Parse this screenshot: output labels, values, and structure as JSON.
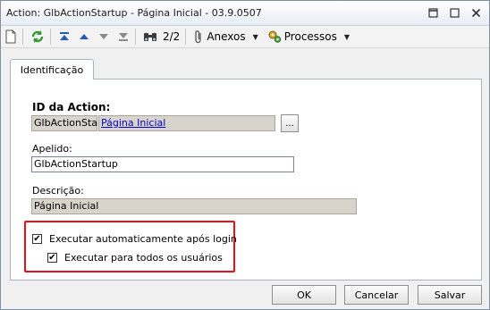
{
  "window": {
    "title": "Action: GlbActionStartup - Página Inicial - 03.9.0507"
  },
  "toolbar": {
    "pager": "2/2",
    "anexos_label": "Anexos",
    "processos_label": "Processos"
  },
  "tabs": [
    {
      "label": "Identificação"
    }
  ],
  "form": {
    "id_label": "ID da Action:",
    "id_value": "GlbActionStar",
    "id_link": "Página Inicial",
    "browse_label": "...",
    "apelido_label": "Apelido:",
    "apelido_value": "GlbActionStartup",
    "descricao_label": "Descrição:",
    "descricao_value": "Página Inicial",
    "auto_exec_label": "Executar automaticamente após login",
    "auto_exec_checked": true,
    "all_users_label": "Executar para todos os usuários",
    "all_users_checked": true
  },
  "footer": {
    "ok_label": "OK",
    "cancel_label": "Cancelar",
    "save_label": "Salvar"
  },
  "colors": {
    "highlight_border": "#e8101a",
    "link": "#0000cc",
    "readonly_bg": "#d8d4cc"
  }
}
